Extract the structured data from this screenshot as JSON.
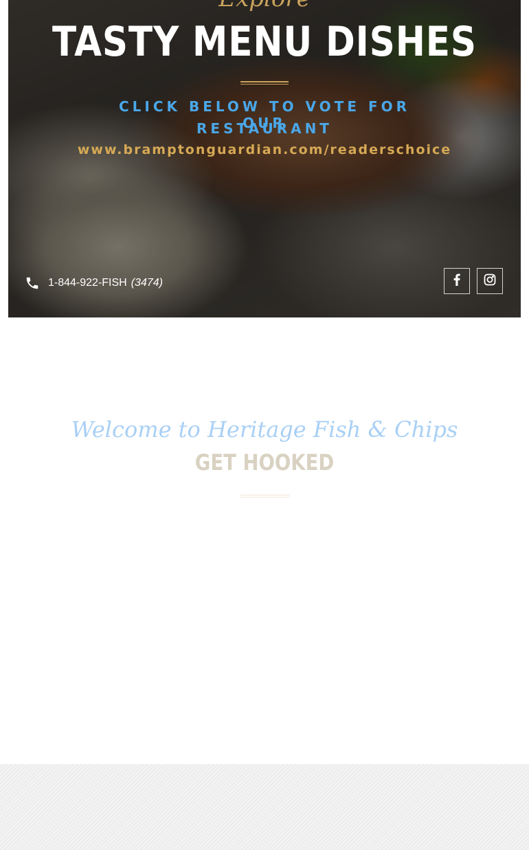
{
  "hero": {
    "script_heading": "Explore",
    "title": "TASTY MENU DISHES",
    "vote_line_1": "CLICK BELOW TO VOTE FOR OUR",
    "vote_line_2": "RESTAURANT",
    "vote_url": "www.bramptonguardian.com/readerschoice",
    "phone_number": "1-844-922-FISH",
    "phone_ext": "(3474)",
    "icons": {
      "phone": "phone-icon",
      "facebook": "facebook-icon",
      "instagram": "instagram-icon"
    }
  },
  "welcome": {
    "script_heading": "Welcome to Heritage Fish & Chips",
    "title": "GET HOOKED"
  },
  "colors": {
    "gold": "#c9a45c",
    "blue": "#4aa7e8",
    "light_blue": "#a9d0f5",
    "white": "#ffffff"
  }
}
